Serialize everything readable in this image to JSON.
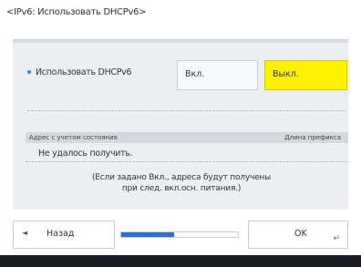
{
  "header": {
    "title": "<IPv6: Использовать DHCPv6>"
  },
  "setting": {
    "label": "Использовать DHCPv6",
    "on_label": "Вкл.",
    "off_label": "Выкл.",
    "selected": "Выкл."
  },
  "table": {
    "col_address": "Адрес с учетом состояния",
    "col_prefix": "Длина префикса",
    "value": "Не удалось получить."
  },
  "note": {
    "line1": "(Если задано Вкл., адреса будут получены",
    "line2": "при след. вкл.осн. питания.)"
  },
  "footer": {
    "back_icon": "◄",
    "back_label": "Назад",
    "progress": 0.45,
    "ok_label": "OK",
    "enter_icon": "↵"
  },
  "colors": {
    "accent": "#2f6fcf",
    "selected": "#fff200"
  }
}
